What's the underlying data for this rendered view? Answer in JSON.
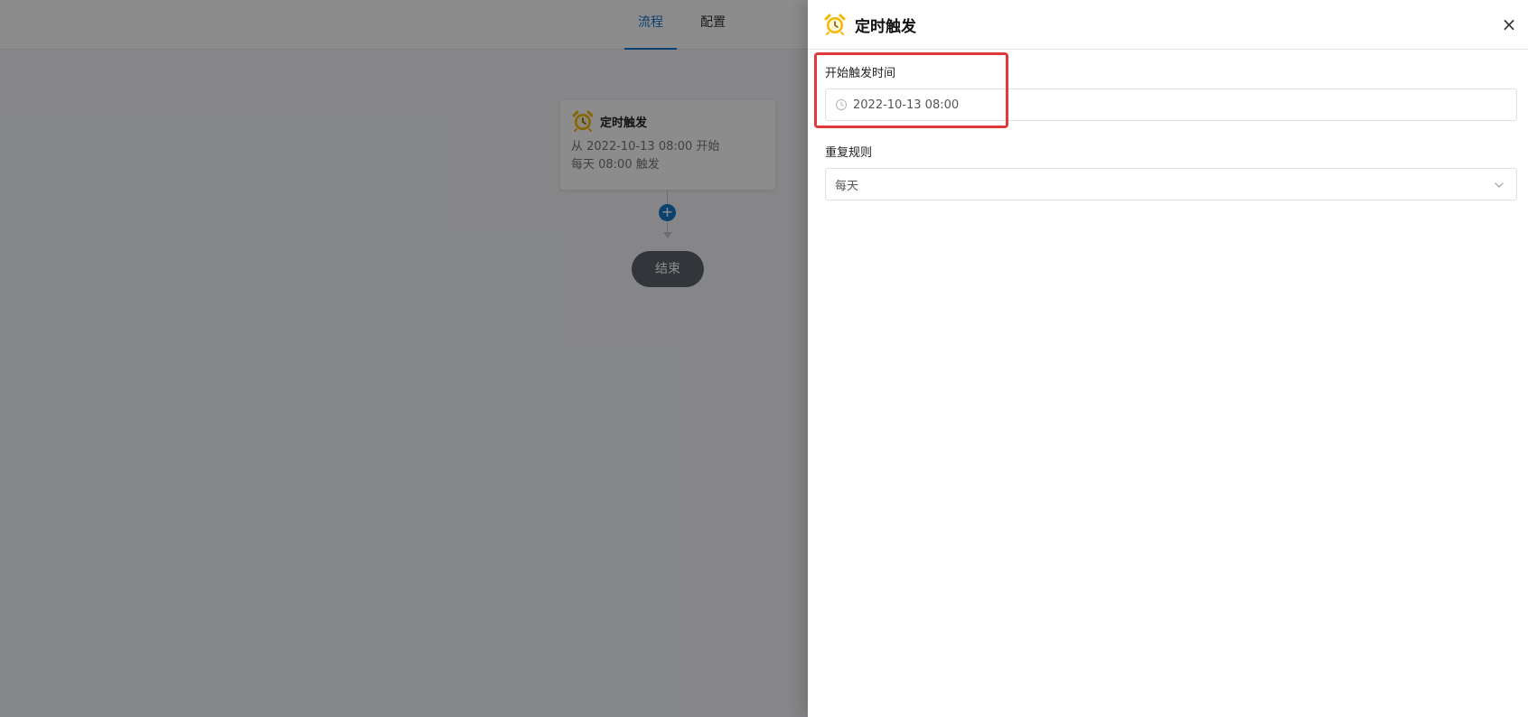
{
  "tabs": {
    "flow": "流程",
    "config": "配置"
  },
  "node": {
    "icon": "alarm-clock-icon",
    "title": "定时触发",
    "line1": "从 2022-10-13 08:00 开始",
    "line2": "每天 08:00 触发"
  },
  "add_button": "+",
  "end_label": "结束",
  "drawer": {
    "icon": "alarm-clock-icon",
    "title": "定时触发",
    "close": "×",
    "start_time": {
      "label": "开始触发时间",
      "value": "2022-10-13 08:00",
      "icon": "clock-icon"
    },
    "repeat": {
      "label": "重复规则",
      "value": "每天",
      "icon": "chevron-down-icon"
    }
  },
  "colors": {
    "accent": "#1577c8",
    "alarm": "#f5b800",
    "highlight": "#e03a3a",
    "end_button": "#5c6168"
  }
}
